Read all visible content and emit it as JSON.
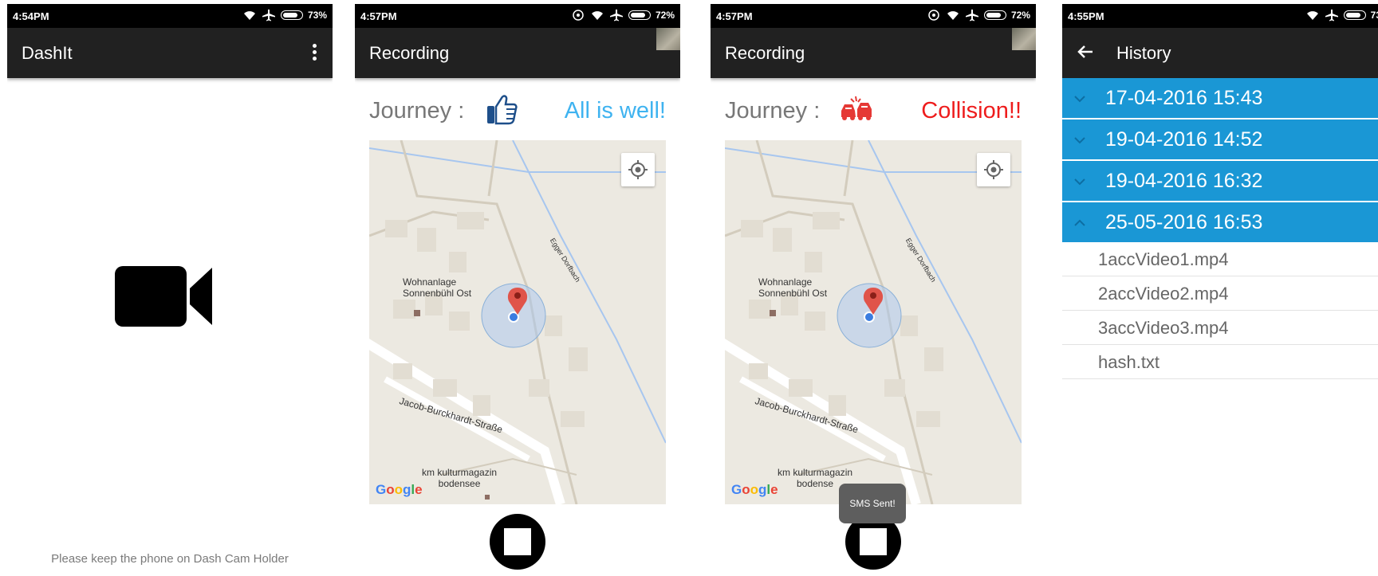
{
  "screens": {
    "home": {
      "status": {
        "time": "4:54PM",
        "battery": "73%"
      },
      "app_title": "DashIt",
      "hint": "Please keep the phone on Dash Cam Holder"
    },
    "recording_ok": {
      "status": {
        "time": "4:57PM",
        "battery": "72%"
      },
      "title": "Recording",
      "journey_label": "Journey :",
      "journey_status": "All is well!",
      "journey_status_color": "#3fb3f0",
      "map": {
        "label_wohnanlage": "Wohnanlage\nSonnenbühl Ost",
        "label_street": "Jacob-Burckhardt-Straße",
        "label_km": "km kulturmagazin\nbodensee",
        "label_stream": "Egger Dorfbach",
        "logo": "Google"
      }
    },
    "recording_collision": {
      "status": {
        "time": "4:57PM",
        "battery": "72%"
      },
      "title": "Recording",
      "journey_label": "Journey :",
      "journey_status": "Collision!!",
      "journey_status_color": "#ee1c1c",
      "toast": "SMS Sent!",
      "map": {
        "label_wohnanlage": "Wohnanlage\nSonnenbühl Ost",
        "label_street": "Jacob-Burckhardt-Straße",
        "label_km": "km kulturmagazin\nbodense",
        "label_stream": "Egger Dorfbach",
        "logo": "Google"
      }
    },
    "history": {
      "status": {
        "time": "4:55PM",
        "battery": "73"
      },
      "title": "History",
      "entries": [
        {
          "date": "17-04-2016 15:43"
        },
        {
          "date": "19-04-2016 14:52"
        },
        {
          "date": "19-04-2016 16:32"
        },
        {
          "date": "25-05-2016 16:53"
        }
      ],
      "files": [
        "1accVideo1.mp4",
        "2accVideo2.mp4",
        "3accVideo3.mp4",
        "hash.txt"
      ]
    }
  }
}
